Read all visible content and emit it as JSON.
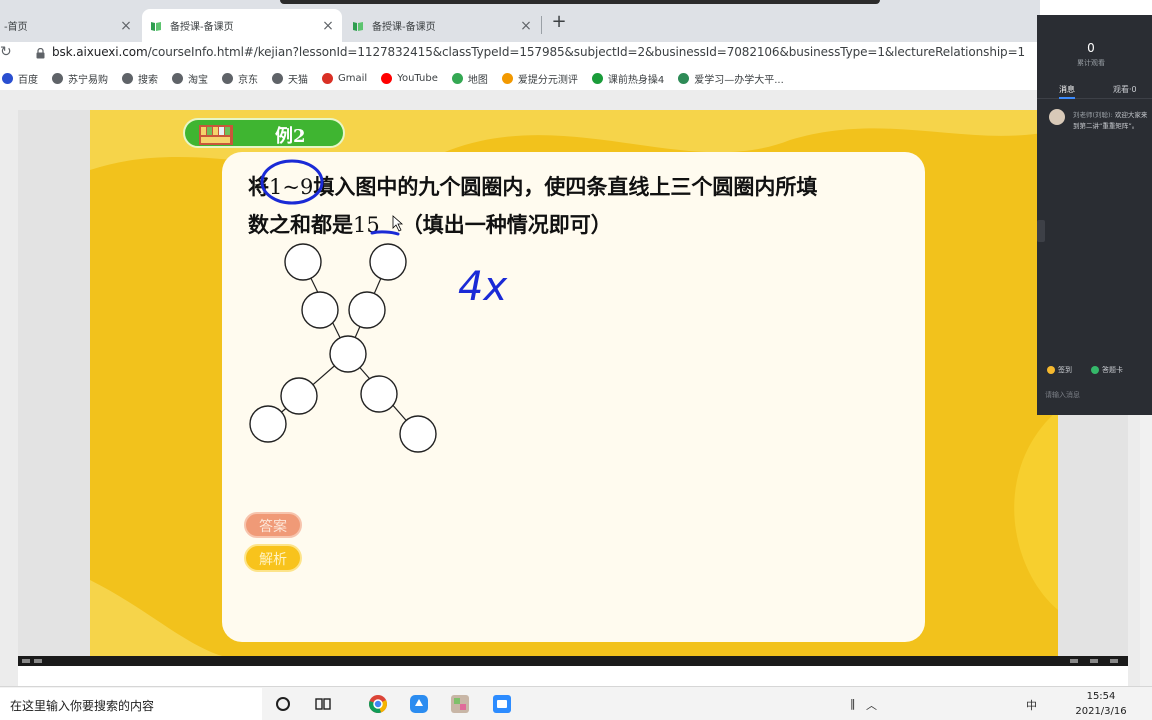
{
  "browser": {
    "tabs": [
      {
        "title": "-首页",
        "active": false
      },
      {
        "title": "备授课-备课页",
        "active": true
      },
      {
        "title": "备授课-备课页",
        "active": false
      }
    ],
    "url_host": "bsk.aixuexi.com",
    "url_path": "/courseInfo.html#/kejian?lessonId=1127832415&classTypeId=157985&subjectId=2&businessId=7082106&businessType=1&lectureRelationship=1",
    "bookmarks": [
      {
        "label": "百度",
        "color": "#2a4fd0"
      },
      {
        "label": "苏宁易购",
        "color": "#5f6368"
      },
      {
        "label": "搜索",
        "color": "#5f6368"
      },
      {
        "label": "淘宝",
        "color": "#5f6368"
      },
      {
        "label": "京东",
        "color": "#5f6368"
      },
      {
        "label": "天猫",
        "color": "#5f6368"
      },
      {
        "label": "Gmail",
        "color": "#d93025"
      },
      {
        "label": "YouTube",
        "color": "#ff0000"
      },
      {
        "label": "地图",
        "color": "#34a853"
      },
      {
        "label": "爱提分元测评",
        "color": "#f29900"
      },
      {
        "label": "课前热身操4",
        "color": "#1a9c3a"
      },
      {
        "label": "爱学习—办学大平...",
        "color": "#2e8b57"
      }
    ]
  },
  "slide": {
    "example_label": "例2",
    "question_line1_pre": "将",
    "question_range": "1~9",
    "question_line1_post": "填入图中的九个圆圈内，使四条直线上三个圆圈内所填",
    "question_line2_pre": "数之和都是",
    "question_sum": "15",
    "question_line2_post": "（填出一种情况即可）",
    "handwriting": "4x",
    "answer_button": "答案",
    "analysis_button": "解析"
  },
  "side_panel": {
    "count": "0",
    "count_label": "累计观看",
    "tab_messages": "消息",
    "tab_viewers": "观看·0",
    "message_sender": "刘老师(刘聪):",
    "message_text": "欢迎大家来到第二讲“重重矩阵”。",
    "chip_signin": "签到",
    "chip_answer_card": "答题卡",
    "input_placeholder": "请输入消息"
  },
  "taskbar": {
    "search_placeholder": "在这里输入你要搜索的内容",
    "time": "15:54",
    "date": "2021/3/16",
    "ime": "中"
  }
}
